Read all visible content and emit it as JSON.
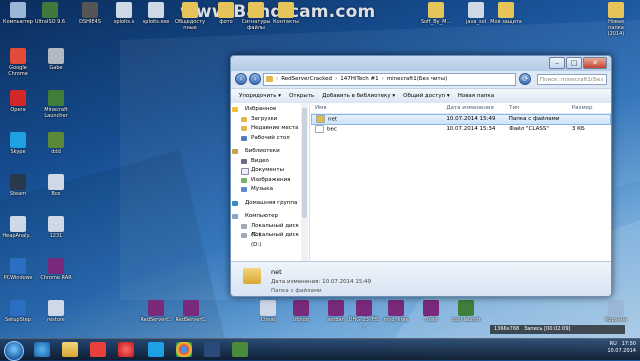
{
  "watermark": "www.Bandicam.com",
  "desktop_icons": [
    {
      "label": "Компьютер",
      "color": "#9bb6d6"
    },
    {
      "label": "UltraISO 9.6",
      "color": "#3e7a3e"
    },
    {
      "label": "DSHIE4S",
      "color": "#555555"
    },
    {
      "label": "sploits.s",
      "color": "#cfd8e6"
    },
    {
      "label": "sploits.exe",
      "color": "#cfd8e6"
    },
    {
      "label": "Общедоступные",
      "color": "#e6c45a"
    },
    {
      "label": "фото",
      "color": "#e6c45a"
    },
    {
      "label": "Сигнатуры файлы",
      "color": "#e6c45a"
    },
    {
      "label": "Контакты",
      "color": "#e6c45a"
    },
    {
      "label": "Soft_By_M...",
      "color": "#e6c45a"
    },
    {
      "label": "java_sol",
      "color": "#cfd8e6"
    },
    {
      "label": "Моя защита",
      "color": "#e6c45a"
    },
    {
      "label": "Новая папка (2014)",
      "color": "#e6c45a"
    },
    {
      "label": "Google Chrome",
      "color": "#e34b3b"
    },
    {
      "label": "Gabe",
      "color": "#b0b8c4"
    },
    {
      "label": "Opera",
      "color": "#d42828"
    },
    {
      "label": "Minecraft Launcher",
      "color": "#3f7f3a"
    },
    {
      "label": "Skype",
      "color": "#1da1e2"
    },
    {
      "label": "ddd",
      "color": "#5a8a3a"
    },
    {
      "label": "Steam",
      "color": "#2a3a4e"
    },
    {
      "label": "Box",
      "color": "#cfd8e6"
    },
    {
      "label": "HeapAnaly...",
      "color": "#cfd8e6"
    },
    {
      "label": "1231",
      "color": "#cfd8e6"
    },
    {
      "label": "PCWindows",
      "color": "#2b6fc2"
    },
    {
      "label": "Chrome RAR",
      "color": "#7a2a7a"
    },
    {
      "label": "SetupStep",
      "color": "#2b6fc2"
    },
    {
      "label": "restore",
      "color": "#cfd8e6"
    },
    {
      "label": "RedServerC...",
      "color": "#7a2a7a"
    },
    {
      "label": "RedServerC...",
      "color": "#7a2a7a"
    },
    {
      "label": "Cheat",
      "color": "#cfd8e6"
    },
    {
      "label": "obhod",
      "color": "#7a2a7a"
    },
    {
      "label": "antban",
      "color": "#7a2a7a"
    },
    {
      "label": "DHG_23_FB...",
      "color": "#7a2a7a"
    },
    {
      "label": "mod_Xray",
      "color": "#7a2a7a"
    },
    {
      "label": "Trash",
      "color": "#7a2a7a"
    },
    {
      "label": "cool launch",
      "color": "#3f7f3a"
    },
    {
      "label": "Корзина",
      "color": "#9bb6d6"
    }
  ],
  "explorer": {
    "breadcrumb": [
      "RedServerCracked",
      "147HiTech #1",
      "minecraft1(Без читы)"
    ],
    "search_placeholder": "Поиск: minecraft1(Без читы)",
    "toolbar": {
      "organize": "Упорядочить ▾",
      "open": "Открыть",
      "add_library": "Добавить в библиотеку ▾",
      "share": "Общий доступ ▾",
      "new_folder": "Новая папка"
    },
    "nav": {
      "favorites_title": "Избранное",
      "favorites": [
        "Загрузки",
        "Недавние места",
        "Рабочий стол"
      ],
      "libraries_title": "Библиотеки",
      "libraries": [
        "Видео",
        "Документы",
        "Изображения",
        "Музыка"
      ],
      "homegroup": "Домашняя группа",
      "computer_title": "Компьютер",
      "drives": [
        "Локальный диск (C:)",
        "Локальный диск (D:)"
      ]
    },
    "columns": {
      "name": "Имя",
      "date": "Дата изменения",
      "type": "Тип",
      "size": "Размер"
    },
    "files": [
      {
        "name": "net",
        "date": "10.07.2014 15:49",
        "type": "Папка с файлами",
        "size": "",
        "icon": "folder-icon",
        "color": "#e3b84a"
      },
      {
        "name": "bec",
        "date": "10.07.2014 15:34",
        "type": "Файл \"CLASS\"",
        "size": "3 КБ",
        "icon": "file-icon",
        "color": "#ffffff"
      }
    ],
    "details": {
      "name": "net",
      "date_label": "Дата изменения: 10.07.2014 15:49",
      "type": "Папка с файлами"
    }
  },
  "recording_bar": "Запись [00:02:09]",
  "resolution": "1366x768",
  "tray": {
    "lang": "RU",
    "time": "17:50",
    "date": "10.07.2014"
  }
}
